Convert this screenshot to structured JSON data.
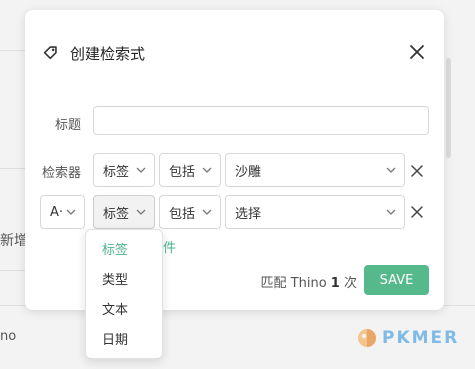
{
  "background": {
    "left_text": "新增",
    "bottom_text": "no"
  },
  "modal": {
    "title": "创建检索式",
    "title_label": "标题",
    "title_value": "",
    "retriever_label": "检索器",
    "rows": [
      {
        "field": "标签",
        "operator": "包括",
        "value": "沙雕"
      },
      {
        "logic": "A·",
        "field": "标签",
        "operator": "包括",
        "value": "选择"
      }
    ],
    "add_condition_partial": "件",
    "match_prefix": "匹配 Thino",
    "match_count": "1",
    "match_suffix": "次",
    "save_label": "SAVE"
  },
  "dropdown": {
    "options": [
      "标签",
      "类型",
      "文本",
      "日期"
    ],
    "selected": "标签"
  },
  "watermark": "PKMER",
  "colors": {
    "accent": "#55b98b",
    "accent_text": "#4cb38a",
    "watermark": "#7fbbe7"
  }
}
